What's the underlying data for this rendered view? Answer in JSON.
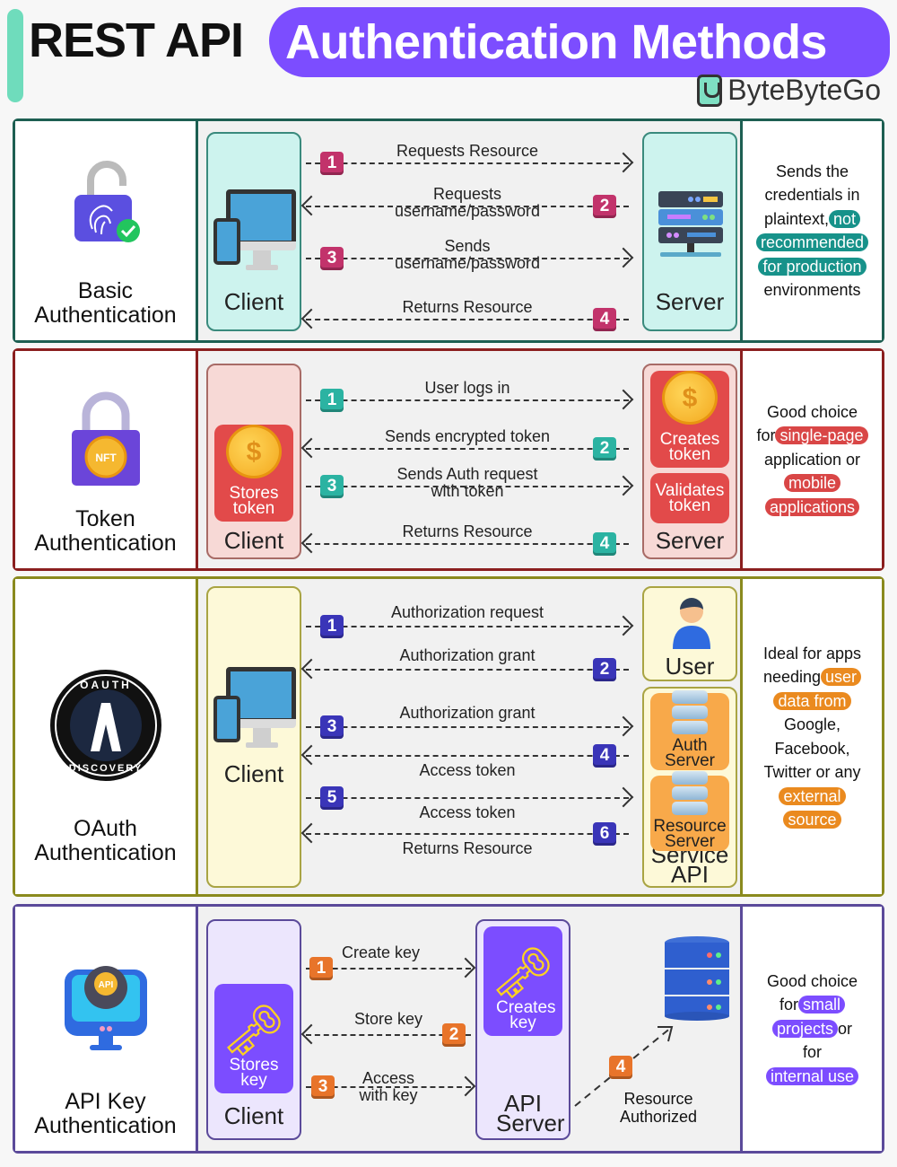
{
  "header": {
    "title_plain": "REST API",
    "title_highlight": "Authentication Methods",
    "brand": "ByteByteGo"
  },
  "colors": {
    "basic": "#1d5f52",
    "token": "#8b1f1f",
    "oauth": "#8a8a1e",
    "apikey": "#5b4a9a",
    "badge_basic": "#c2336b",
    "badge_token": "#2bb3a2",
    "badge_oauth": "#3a35b8",
    "badge_apikey": "#e8742a",
    "title_blob": "#7c4dff"
  },
  "sections": [
    {
      "id": "basic",
      "name_line1": "Basic",
      "name_line2": "Authentication",
      "icon": "fingerprint-padlock-icon",
      "client_label": "Client",
      "server_label": "Server",
      "flows": [
        {
          "step": "1",
          "text": "Requests Resource",
          "direction": "right"
        },
        {
          "step": "2",
          "text": "Requests\nusername/password",
          "direction": "left"
        },
        {
          "step": "3",
          "text": "Sends\nusername/password",
          "direction": "right"
        },
        {
          "step": "4",
          "text": "Returns Resource",
          "direction": "left"
        }
      ],
      "note": {
        "plain1": "Sends the credentials in plaintext,",
        "hl1": "not",
        "hl2": "recommended",
        "hl3": "for production",
        "plain2": "environments"
      }
    },
    {
      "id": "token",
      "name_line1": "Token",
      "name_line2": "Authentication",
      "icon": "nft-padlock-icon",
      "client_label": "Client",
      "client_inner": "Stores token",
      "server_label": "Server",
      "server_inner1": "Creates token",
      "server_inner2": "Validates token",
      "flows": [
        {
          "step": "1",
          "text": "User logs in",
          "direction": "right"
        },
        {
          "step": "2",
          "text": "Sends encrypted token",
          "direction": "left"
        },
        {
          "step": "3",
          "text": "Sends Auth request\nwith token",
          "direction": "right"
        },
        {
          "step": "4",
          "text": "Returns Resource",
          "direction": "left"
        }
      ],
      "note": {
        "plain1": "Good choice",
        "plain2": "for",
        "hl1": "single-page",
        "plain3": "application or",
        "hl2": "mobile",
        "hl3": "applications"
      }
    },
    {
      "id": "oauth",
      "name_line1": "OAuth",
      "name_line2": "Authentication",
      "icon": "oauth-discovery-logo",
      "logo_top": "OAUTH",
      "logo_bottom": "DISCOVERY",
      "logo_letter": "A",
      "client_label": "Client",
      "user_label": "User",
      "auth_server": "Auth Server",
      "resource_server": "Resource Server",
      "service_api": "Service API",
      "flows": [
        {
          "step": "1",
          "text": "Authorization request",
          "direction": "right"
        },
        {
          "step": "2",
          "text": "Authorization grant",
          "direction": "left"
        },
        {
          "step": "3",
          "text": "Authorization grant",
          "direction": "right"
        },
        {
          "step": "4",
          "text": "Access token",
          "direction": "left"
        },
        {
          "step": "5",
          "text": "Access token",
          "direction": "right"
        },
        {
          "step": "6",
          "text": "Returns Resource",
          "direction": "left"
        }
      ],
      "note": {
        "plain1": "Ideal for apps",
        "plain2": "needing",
        "hl1": "user",
        "hl2": "data from",
        "plain3": "Google,",
        "plain4": "Facebook,",
        "plain5": "Twitter or any",
        "hl3": "external",
        "hl4": "source"
      }
    },
    {
      "id": "apikey",
      "name_line1": "API Key",
      "name_line2": "Authentication",
      "icon": "api-monitor-gear-icon",
      "icon_text": "API",
      "client_label": "Client",
      "client_inner": "Stores key",
      "server_label": "API Server",
      "server_inner": "Creates key",
      "resource_label": "Resource Authorized",
      "flows": [
        {
          "step": "1",
          "text": "Create key",
          "direction": "right"
        },
        {
          "step": "2",
          "text": "Store key",
          "direction": "left"
        },
        {
          "step": "3",
          "text": "Access\nwith key",
          "direction": "right"
        },
        {
          "step": "4",
          "text": "",
          "direction": "up-right"
        }
      ],
      "note": {
        "plain1": "Good choice",
        "plain2": "for",
        "hl1": "small",
        "hl2": "projects",
        "plain3": "or",
        "plain4": "for",
        "hl3": "internal use"
      }
    }
  ]
}
